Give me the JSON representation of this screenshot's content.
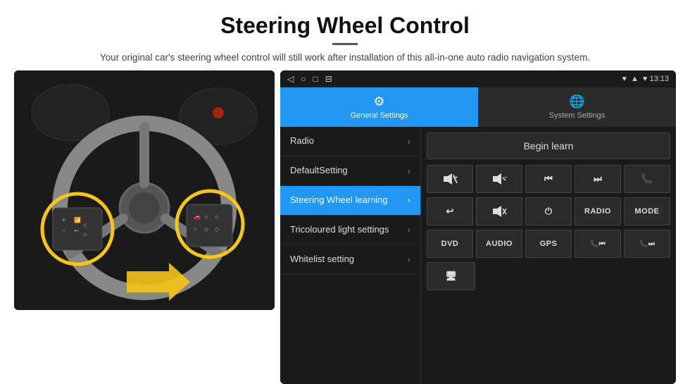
{
  "header": {
    "title": "Steering Wheel Control",
    "divider": true,
    "description": "Your original car's steering wheel control will still work after installation of this all-in-one auto radio navigation system."
  },
  "status_bar": {
    "icons": [
      "◁",
      "○",
      "□",
      "⊟"
    ],
    "right": "♥  13:13"
  },
  "tabs": [
    {
      "id": "general",
      "label": "General Settings",
      "active": true
    },
    {
      "id": "system",
      "label": "System Settings",
      "active": false
    }
  ],
  "menu_items": [
    {
      "id": "radio",
      "label": "Radio",
      "active": false
    },
    {
      "id": "default",
      "label": "DefaultSetting",
      "active": false
    },
    {
      "id": "steering",
      "label": "Steering Wheel learning",
      "active": true
    },
    {
      "id": "tricoloured",
      "label": "Tricoloured light settings",
      "active": false
    },
    {
      "id": "whitelist",
      "label": "Whitelist setting",
      "active": false
    }
  ],
  "controls": {
    "begin_learn_label": "Begin learn",
    "row1": [
      "🔊+",
      "🔊−",
      "⏮",
      "⏭",
      "📞"
    ],
    "row1_symbols": [
      "+vol",
      "-vol",
      "|◀◀",
      "▶▶|",
      "☎"
    ],
    "row2": [
      "↩",
      "🔇×",
      "⏻",
      "RADIO",
      "MODE"
    ],
    "row3": [
      "DVD",
      "AUDIO",
      "GPS",
      "📞⏮",
      "📞⏭"
    ]
  }
}
